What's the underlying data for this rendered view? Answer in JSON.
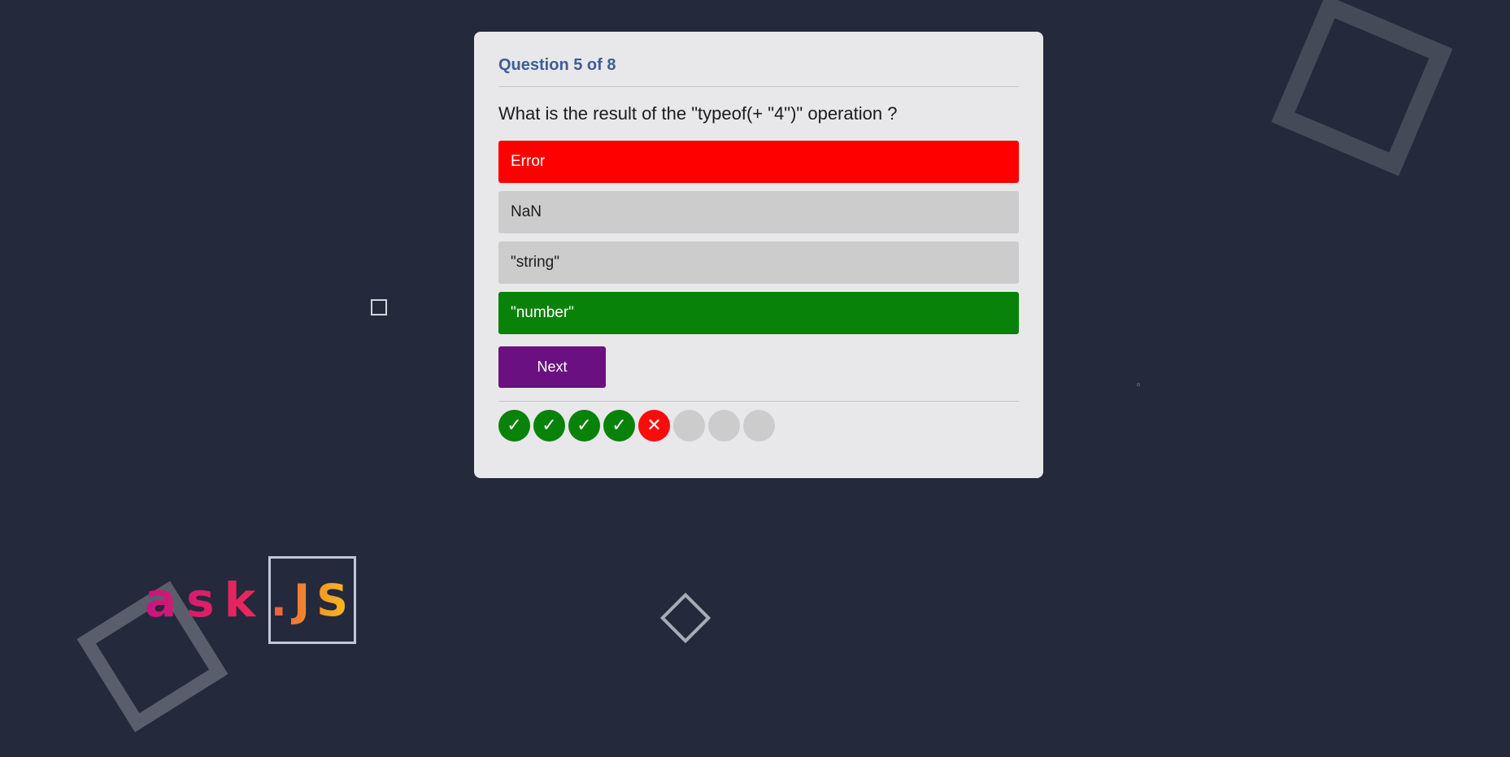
{
  "quiz": {
    "counter": "Question 5 of 8",
    "question": "What is the result of the \"typeof(+ \"4\")\" operation ?",
    "options": [
      {
        "label": "Error",
        "state": "wrong"
      },
      {
        "label": "NaN",
        "state": "neutral"
      },
      {
        "label": "\"string\"",
        "state": "neutral"
      },
      {
        "label": "\"number\"",
        "state": "correct"
      }
    ],
    "next_label": "Next",
    "progress": [
      {
        "status": "correct",
        "icon": "check-icon",
        "glyph": "✓"
      },
      {
        "status": "correct",
        "icon": "check-icon",
        "glyph": "✓"
      },
      {
        "status": "correct",
        "icon": "check-icon",
        "glyph": "✓"
      },
      {
        "status": "correct",
        "icon": "check-icon",
        "glyph": "✓"
      },
      {
        "status": "wrong",
        "icon": "cross-icon",
        "glyph": "✕"
      },
      {
        "status": "pending",
        "icon": "",
        "glyph": ""
      },
      {
        "status": "pending",
        "icon": "",
        "glyph": ""
      },
      {
        "status": "pending",
        "icon": "",
        "glyph": ""
      }
    ]
  },
  "logo": {
    "ask": "ask",
    "js": ".JS"
  },
  "colors": {
    "background": "#242a3c",
    "card": "#e8e8ea",
    "counter": "#3e5d95",
    "wrong": "#ff0000",
    "correct": "#088208",
    "neutral": "#cccccc",
    "next_button": "#6b1080"
  }
}
